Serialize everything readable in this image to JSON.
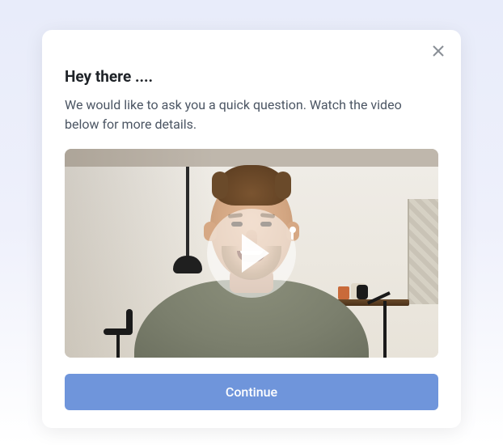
{
  "modal": {
    "title": "Hey there ....",
    "description": "We would like to ask you a quick question. Watch the video below for more details.",
    "continue_label": "Continue"
  }
}
